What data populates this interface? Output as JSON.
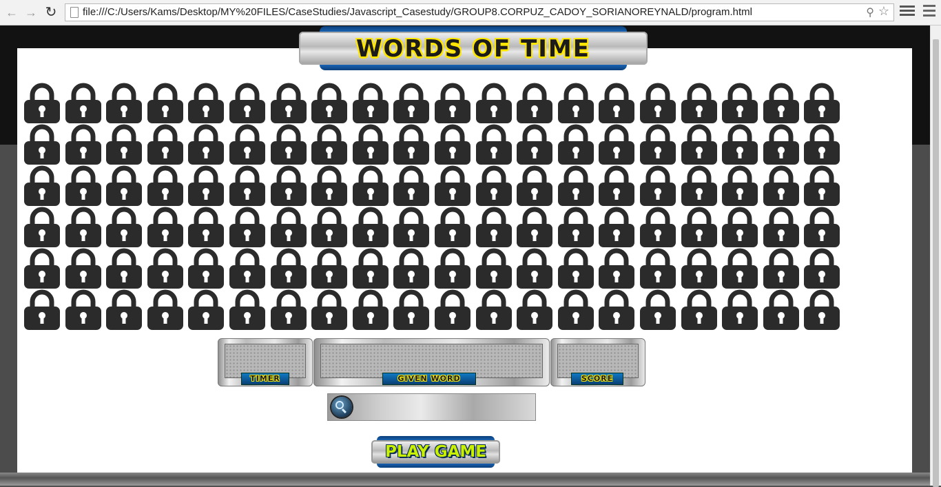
{
  "browser": {
    "url": "file:///C:/Users/Kams/Desktop/MY%20FILES/CaseStudies/Javascript_Casestudy/GROUP8.CORPUZ_CADOY_SORIANOREYNALD/program.html",
    "icons": [
      "back-icon",
      "forward-icon",
      "reload-icon",
      "page-icon",
      "zoom-icon",
      "bookmark-star-icon",
      "menu-icon"
    ]
  },
  "game": {
    "title": "WORDS OF TIME",
    "grid": {
      "rows": 6,
      "columns": 20,
      "tile_icon": "padlock-icon",
      "tile_color": "#2b2b2b"
    },
    "panels": {
      "timer_label": "TIMER",
      "timer_value": "",
      "word_label": "GIVEN WORD",
      "word_value": "",
      "score_label": "SCORE",
      "score_value": ""
    },
    "input": {
      "value": "",
      "placeholder": ""
    },
    "play_label": "PLAY GAME"
  },
  "colors": {
    "accent_blue": "#1d6cc0",
    "title_yellow": "#ffe600",
    "play_green": "#c8f000",
    "card_bg": "#ffffff"
  }
}
